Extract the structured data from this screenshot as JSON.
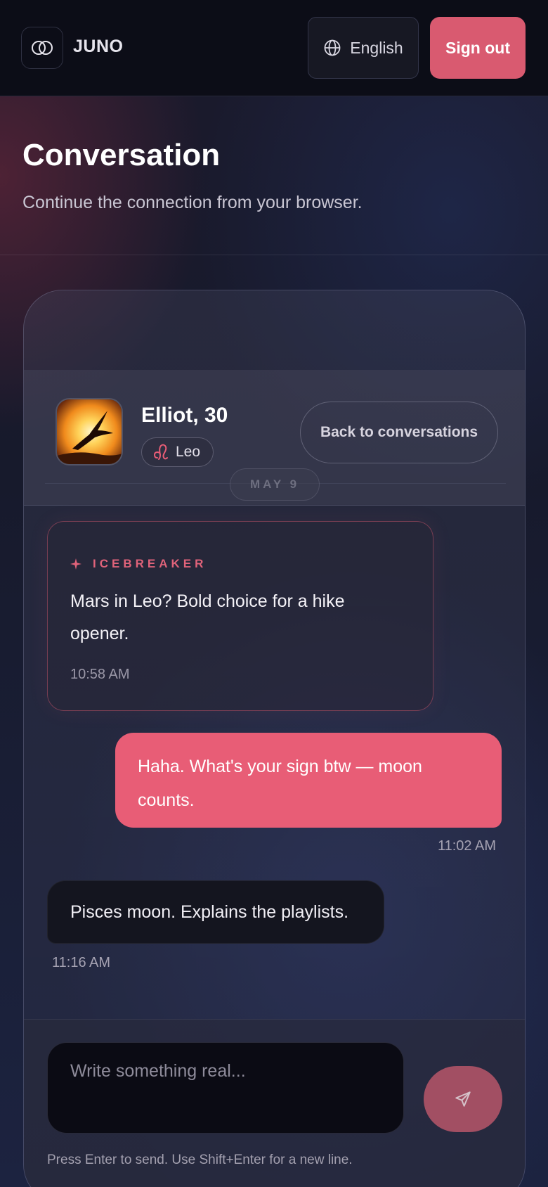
{
  "app": {
    "brand": "JUNO",
    "language_label": "English",
    "signout_label": "Sign out"
  },
  "header": {
    "title": "Conversation",
    "subtitle": "Continue the connection from your browser."
  },
  "match": {
    "name_age": "Elliot, 30",
    "sign": "Leo",
    "sign_symbol": "♌",
    "back_label": "Back to conversations"
  },
  "date_divider": "MAY 9",
  "messages": [
    {
      "type": "icebreaker",
      "label": "ICEBREAKER",
      "text": "Mars in Leo? Bold choice for a hike opener.",
      "time": "10:58 AM"
    },
    {
      "type": "outgoing",
      "text": "Haha. What's your sign btw — moon counts.",
      "time": "11:02 AM"
    },
    {
      "type": "incoming",
      "text": "Pisces moon. Explains the playlists.",
      "time": "11:16 AM"
    }
  ],
  "composer": {
    "placeholder": "Write something real...",
    "hint": "Press Enter to send. Use Shift+Enter for a new line."
  },
  "colors": {
    "accent": "#e85d76",
    "signout": "#d95a70",
    "topbar": "#0c0d17"
  }
}
